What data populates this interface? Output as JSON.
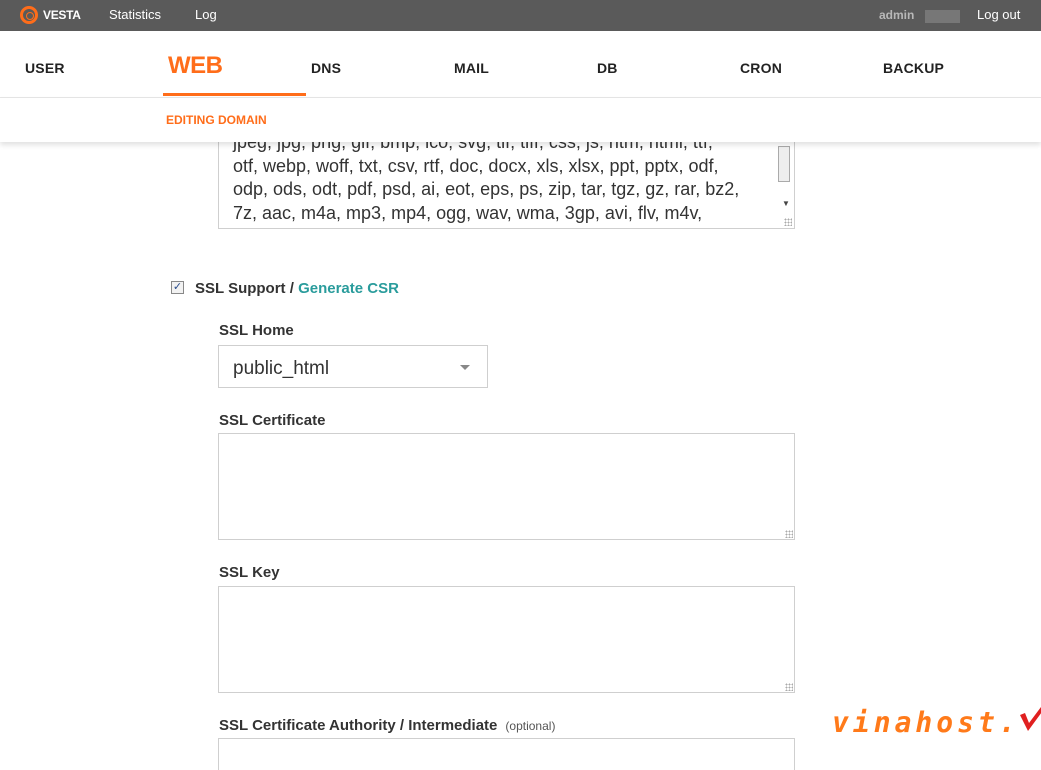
{
  "topbar": {
    "logo_text": "VESTA",
    "links": [
      "Statistics",
      "Log"
    ],
    "user": "admin",
    "logout": "Log out"
  },
  "nav": {
    "items": [
      "USER",
      "WEB",
      "DNS",
      "MAIL",
      "DB",
      "CRON",
      "BACKUP"
    ],
    "active": "WEB"
  },
  "subnav": {
    "label": "EDITING DOMAIN"
  },
  "extensions": {
    "lines": [
      "jpeg, jpg, png, gif, bmp, ico, svg, tif, tiff, css, js, htm, html, ttf,",
      "otf, webp, woff, txt, csv, rtf, doc, docx, xls, xlsx, ppt, pptx, odf,",
      "odp, ods, odt, pdf, psd, ai, eot, eps, ps, zip, tar, tgz, gz, rar, bz2,",
      "7z, aac, m4a, mp3, mp4, ogg, wav, wma, 3gp, avi, flv, m4v,"
    ]
  },
  "ssl": {
    "checked": true,
    "label": "SSL Support /",
    "generate_csr": "Generate CSR",
    "home_label": "SSL Home",
    "home_value": "public_html",
    "certificate_label": "SSL Certificate",
    "key_label": "SSL Key",
    "ca_label": "SSL Certificate Authority / Intermediate",
    "ca_optional": "(optional)"
  },
  "watermark": {
    "text": "vinahost."
  },
  "colors": {
    "accent": "#ff6d1a",
    "link": "#2a9c9c",
    "topbar": "#5a5a5a",
    "watermark_check": "#e02020"
  }
}
